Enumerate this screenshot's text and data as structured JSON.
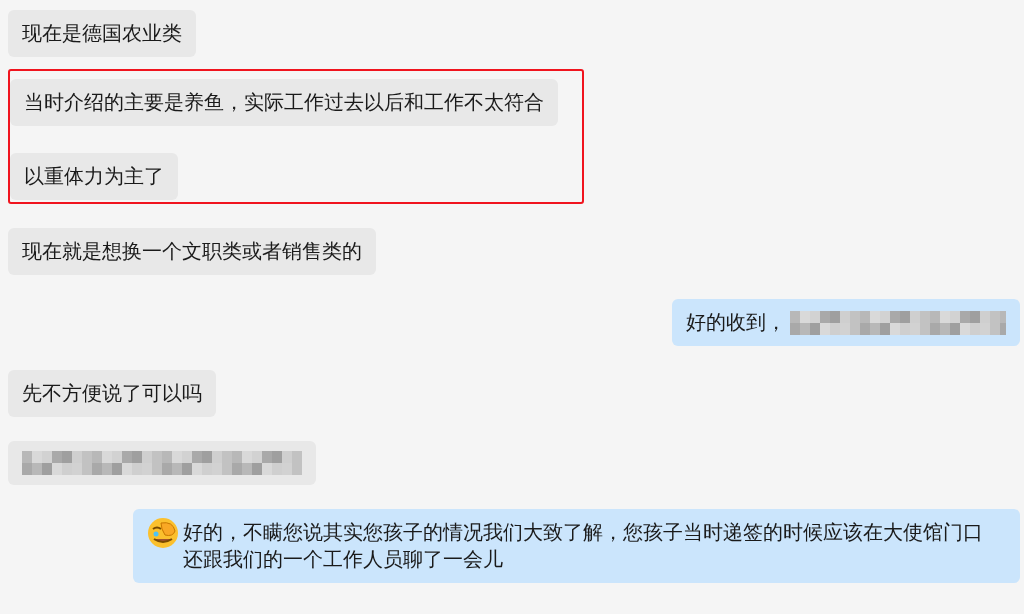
{
  "messages": [
    {
      "kind": "incoming",
      "parts": [
        {
          "kind": "text",
          "text": "现在是德国农业类"
        }
      ]
    },
    {
      "kind": "highlight",
      "messages": [
        {
          "kind": "incoming",
          "parts": [
            {
              "kind": "text",
              "text": "当时介绍的主要是养鱼，实际工作过去以后和工作不太符合"
            }
          ]
        },
        {
          "kind": "incoming",
          "parts": [
            {
              "kind": "text",
              "text": "以重体力为主了"
            }
          ]
        }
      ]
    },
    {
      "kind": "incoming",
      "parts": [
        {
          "kind": "text",
          "text": "现在就是想换一个文职类或者销售类的"
        }
      ]
    },
    {
      "kind": "outgoing",
      "parts": [
        {
          "kind": "text",
          "text": "好的收到，"
        },
        {
          "kind": "redacted"
        }
      ]
    },
    {
      "kind": "incoming",
      "parts": [
        {
          "kind": "text",
          "text": "先不方便说了可以吗"
        }
      ]
    },
    {
      "kind": "incoming",
      "parts": [
        {
          "kind": "redacted"
        }
      ]
    },
    {
      "kind": "outgoing",
      "parts": [
        {
          "kind": "emoji"
        },
        {
          "kind": "text",
          "text": "好的，不瞒您说其实您孩子的情况我们大致了解，您孩子当时递签的时候应该在大使馆门口还跟我们的一个工作人员聊了一会儿"
        }
      ]
    }
  ]
}
